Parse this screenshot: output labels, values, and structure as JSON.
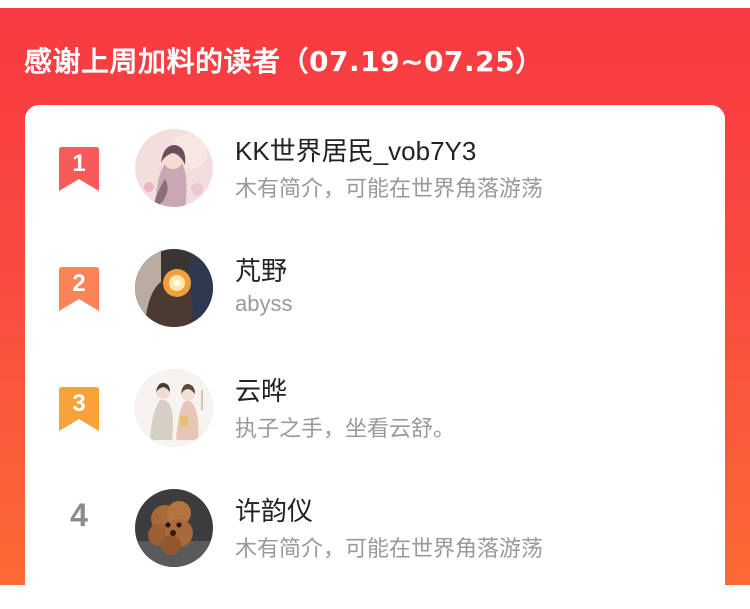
{
  "header": {
    "title": "感谢上周加料的读者（07.19~07.25）"
  },
  "colors": {
    "banner_top": "#f83a42",
    "banner_bottom": "#fb6a34",
    "rank1": "#f65a5a",
    "rank2": "#fa8458",
    "rank3": "#f9a23a",
    "rank_plain": "#8b8b8b"
  },
  "readers": [
    {
      "rank": "1",
      "name": "KK世界居民_vob7Y3",
      "bio": "木有简介，可能在世界角落游荡",
      "avatar": "avatar-girl-illustration"
    },
    {
      "rank": "2",
      "name": "芃野",
      "bio": "abyss",
      "avatar": "avatar-light-photo"
    },
    {
      "rank": "3",
      "name": "云晔",
      "bio": "执子之手，坐看云舒。",
      "avatar": "avatar-two-figures-illustration"
    },
    {
      "rank": "4",
      "name": "许韵仪",
      "bio": "木有简介，可能在世界角落游荡",
      "avatar": "avatar-poodle-photo"
    }
  ]
}
